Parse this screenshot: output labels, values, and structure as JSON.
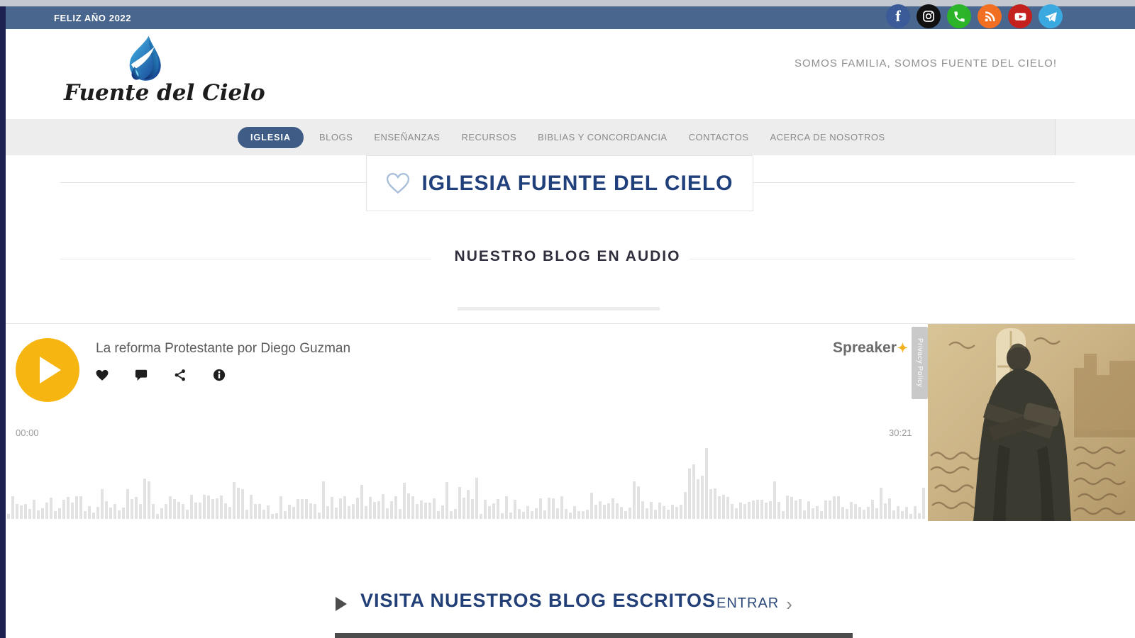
{
  "topbar": {
    "greeting": "FELIZ AÑO 2022",
    "social": [
      {
        "name": "facebook",
        "bg": "#3a5a98"
      },
      {
        "name": "instagram",
        "bg": "#111111"
      },
      {
        "name": "whatsapp",
        "bg": "#2bb32a"
      },
      {
        "name": "rss",
        "bg": "#f26f21"
      },
      {
        "name": "youtube",
        "bg": "#c4201d"
      },
      {
        "name": "telegram",
        "bg": "#3aa9e0"
      }
    ]
  },
  "header": {
    "logo_text": "Fuente del Cielo",
    "tagline": "SOMOS FAMILIA, SOMOS FUENTE DEL CIELO!"
  },
  "nav": {
    "items": [
      {
        "label": "IGLESIA",
        "active": true
      },
      {
        "label": "BLOGS"
      },
      {
        "label": "ENSEÑANZAS"
      },
      {
        "label": "RECURSOS"
      },
      {
        "label": "BIBLIAS Y CONCORDANCIA"
      },
      {
        "label": "CONTACTOS"
      },
      {
        "label": "ACERCA DE NOSOTROS"
      }
    ]
  },
  "page": {
    "title": "IGLESIA FUENTE DEL CIELO",
    "section_heading": "NUESTRO BLOG EN AUDIO"
  },
  "player": {
    "episode_title": "La reforma Protestante por Diego Guzman",
    "current_time": "00:00",
    "duration": "30:21",
    "brand": "Spreaker",
    "brand_star": "✦",
    "privacy_label": "Privacy Policy",
    "colors": {
      "play_button": "#f7b512",
      "waveform": "#e2e2e2",
      "accent_navy": "#20407c",
      "topbar_blue": "#49678e",
      "left_stripe": "#1c2152"
    }
  },
  "footer_section": {
    "heading": "VISITA NUESTROS BLOG ESCRITOS",
    "cta": "ENTRAR",
    "cta_chevron": "›"
  }
}
